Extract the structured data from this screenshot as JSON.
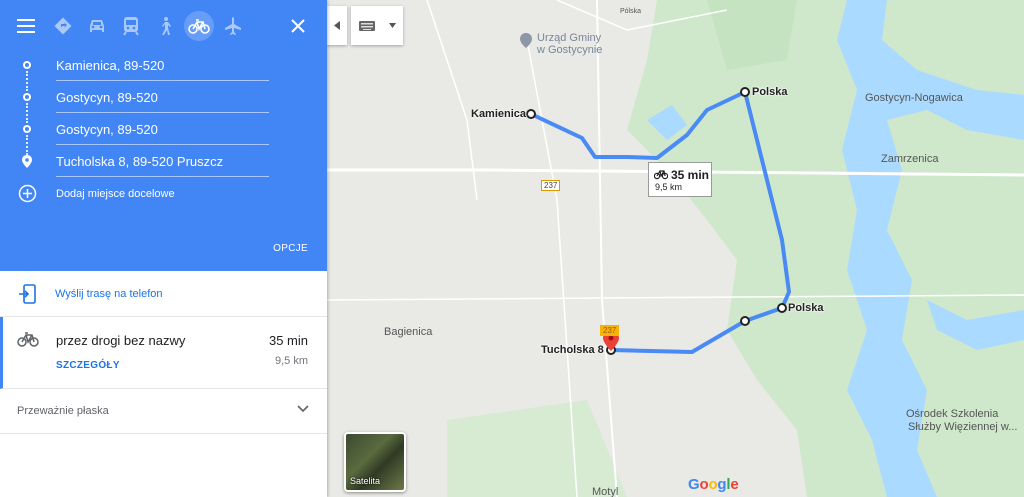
{
  "panel": {
    "modes": [
      {
        "name": "best-route",
        "icon": "diamond-route-icon"
      },
      {
        "name": "car",
        "icon": "car-icon"
      },
      {
        "name": "transit",
        "icon": "train-icon"
      },
      {
        "name": "walking",
        "icon": "walking-icon"
      },
      {
        "name": "cycling",
        "icon": "bicycle-icon",
        "active": true
      },
      {
        "name": "flight",
        "icon": "airplane-icon"
      }
    ],
    "waypoints": [
      "Kamienica, 89-520",
      "Gostycyn, 89-520",
      "Gostycyn, 89-520",
      "Tucholska 8, 89-520 Pruszcz"
    ],
    "add_destination": "Dodaj miejsce docelowe",
    "options": "OPCJE",
    "send_to_phone": "Wyślij trasę na telefon",
    "route": {
      "via": "przez drogi bez nazwy",
      "time": "35 min",
      "distance": "9,5 km",
      "details": "SZCZEGÓŁY"
    },
    "elevation": "Przeważnie płaska",
    "colors": {
      "header": "#4285f4",
      "link": "#1a73e8"
    }
  },
  "map": {
    "labels": {
      "polska_top": "Pólska",
      "urzad": "Urząd Gminy",
      "urzad2": "w Gostycynie",
      "kamienica": "Kamienica",
      "polska1": "Polska",
      "gostycyn_nogawica": "Gostycyn-Nogawica",
      "zamrzenica": "Zamrzenica",
      "polska2": "Polska",
      "bagienica": "Bagienica",
      "tucholska": "Tucholska 8",
      "osrodek1": "Ośrodek Szkolenia",
      "osrodek2": "Służby Więziennej w...",
      "motyl": "Motyl",
      "road237_a": "237",
      "road237_b": "237"
    },
    "route_box": {
      "time": "35 min",
      "distance": "9,5 km"
    },
    "satellite": "Satelita",
    "google": [
      "G",
      "o",
      "o",
      "g",
      "l",
      "e"
    ],
    "route_color": "#4a8af4"
  }
}
